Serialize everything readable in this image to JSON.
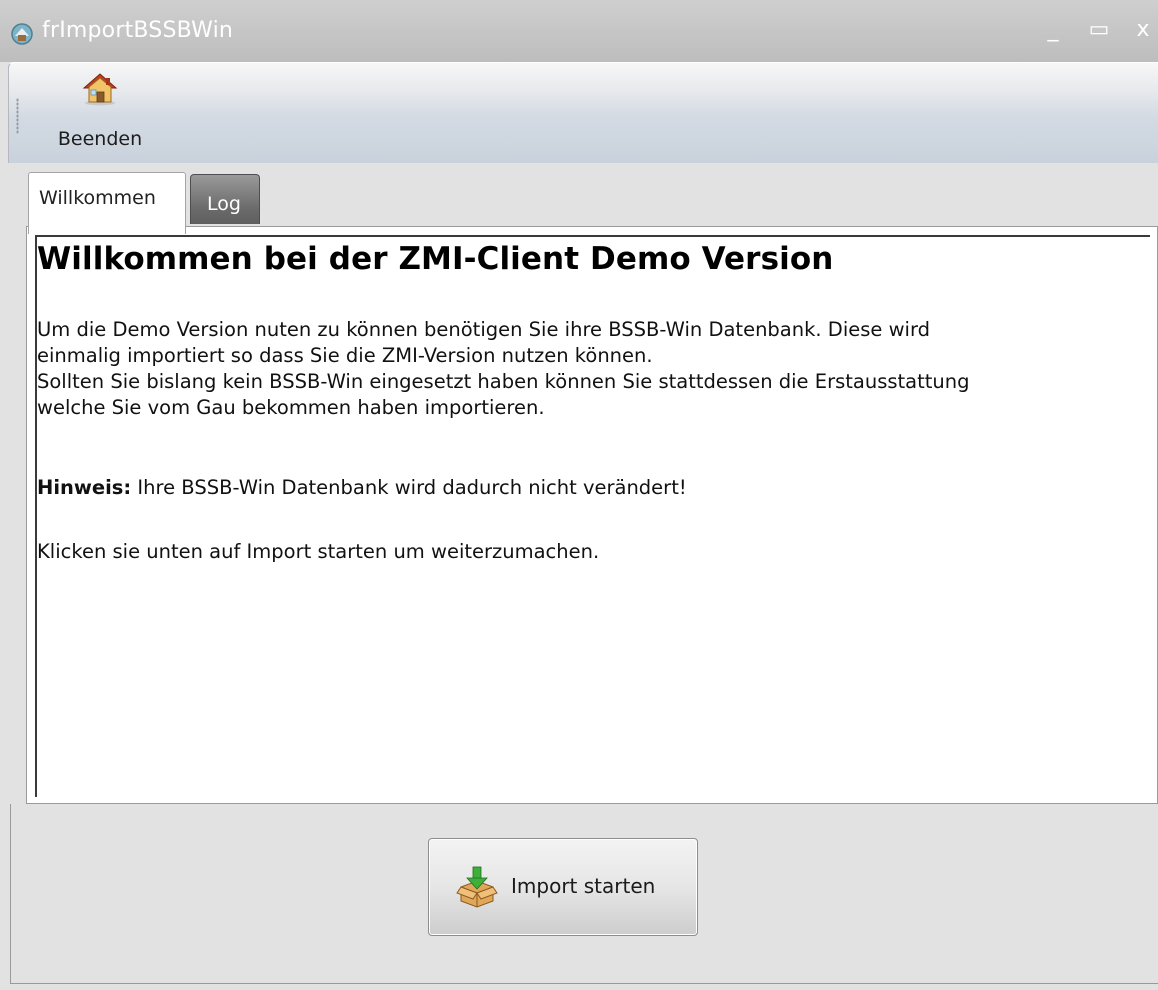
{
  "window": {
    "title": "frImportBSSBWin",
    "controls": {
      "minimize": "_",
      "maximize": "▭",
      "close": "x"
    }
  },
  "toolbar": {
    "buttons": [
      {
        "label": "Beenden",
        "icon": "house-icon"
      }
    ]
  },
  "tabs": [
    {
      "label": "Willkommen",
      "active": true
    },
    {
      "label": "Log",
      "active": false
    }
  ],
  "welcome": {
    "heading": "Willkommen bei der ZMI-Client Demo Version",
    "paragraph1_line1": "Um die Demo Version nuten zu können benötigen Sie ihre BSSB-Win Datenbank. Diese wird",
    "paragraph1_line2": "einmalig importiert so dass Sie die ZMI-Version nutzen können.",
    "paragraph2_line1": "Sollten Sie bislang kein BSSB-Win eingesetzt haben können Sie stattdessen die Erstausstattung",
    "paragraph2_line2": "welche Sie vom Gau bekommen haben importieren.",
    "hint_label": "Hinweis:",
    "hint_text": " Ihre BSSB-Win Datenbank wird dadurch nicht verändert!",
    "instruction": "Klicken sie unten auf Import starten um weiterzumachen."
  },
  "actions": {
    "import_label": "Import starten",
    "import_icon": "box-download-icon"
  }
}
